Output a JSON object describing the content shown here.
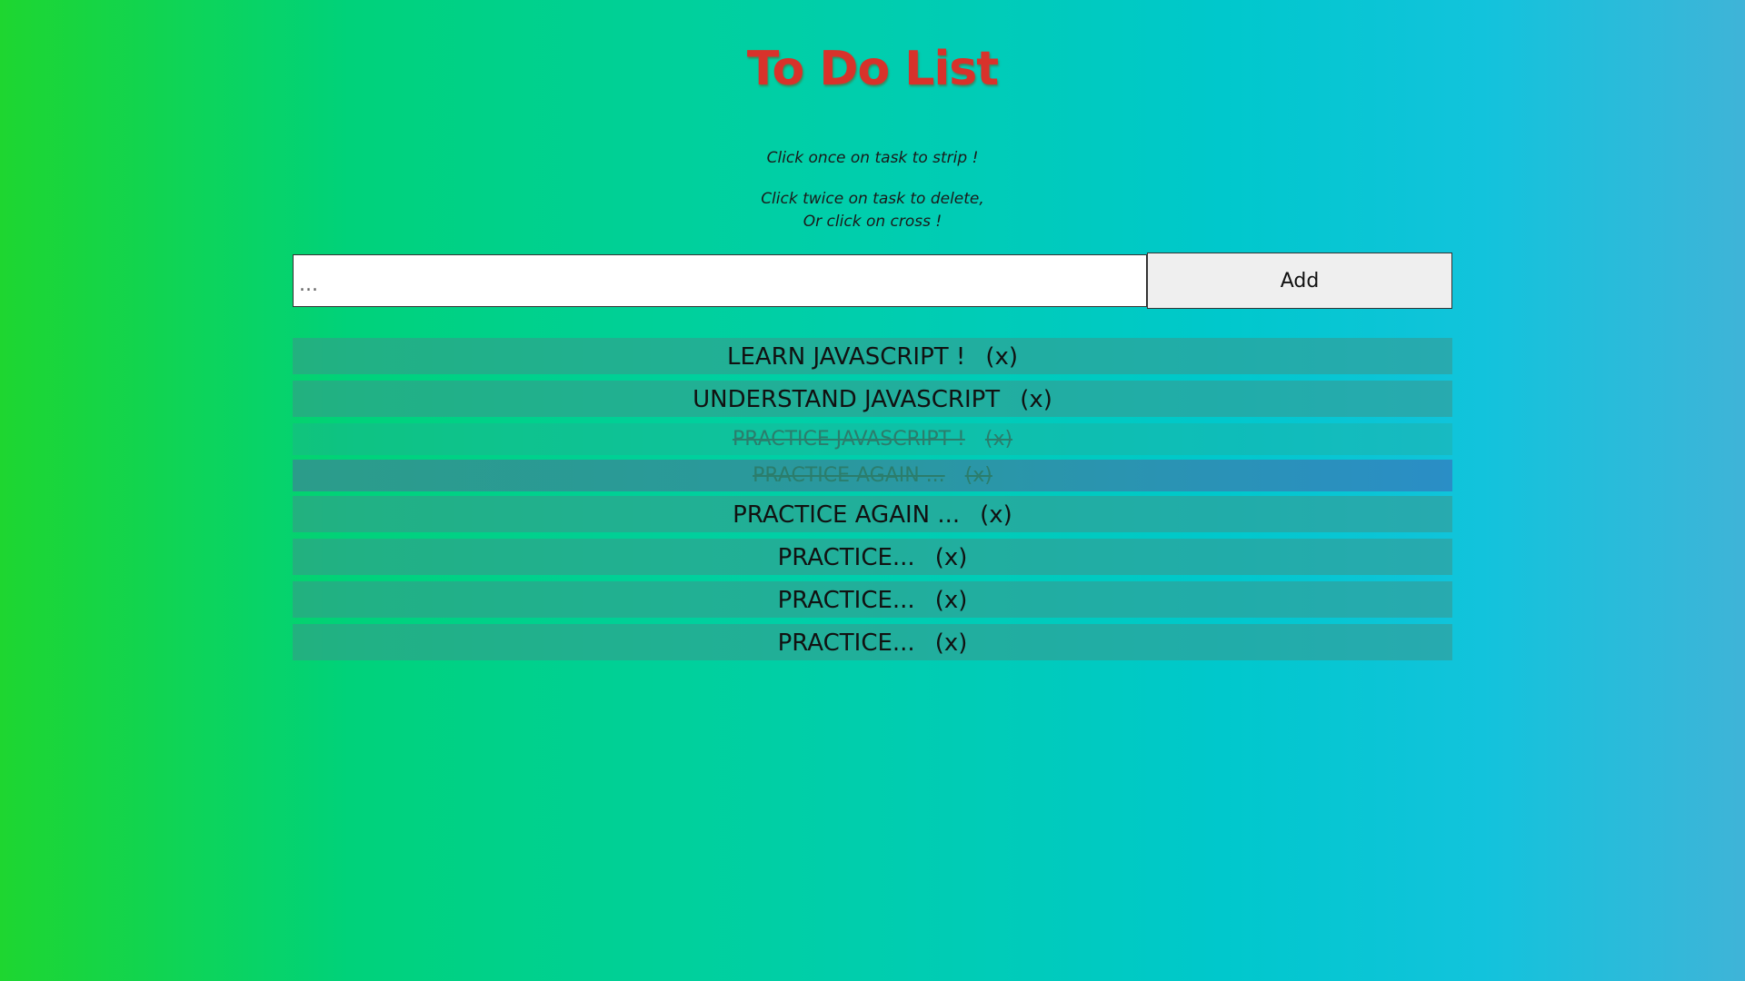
{
  "header": {
    "title": "To Do List"
  },
  "instructions": {
    "line1": "Click once on task to strip !",
    "line2": "Click twice on task to delete,",
    "line3": "Or click on cross !"
  },
  "input": {
    "placeholder": "...",
    "value": ""
  },
  "add_button": {
    "label": "Add"
  },
  "tasks": [
    {
      "text": "LEARN JAVASCRIPT !",
      "cross": "(x)",
      "done": false
    },
    {
      "text": "UNDERSTAND JAVASCRIPT",
      "cross": "(x)",
      "done": false
    },
    {
      "text": "PRACTICE JAVASCRIPT !",
      "cross": "(x)",
      "done": true
    },
    {
      "text": "PRACTICE AGAIN ...",
      "cross": "(x)",
      "done": true
    },
    {
      "text": "PRACTICE AGAIN ...",
      "cross": "(x)",
      "done": false
    },
    {
      "text": "PRACTICE...",
      "cross": "(x)",
      "done": false
    },
    {
      "text": "PRACTICE...",
      "cross": "(x)",
      "done": false
    },
    {
      "text": "PRACTICE...",
      "cross": "(x)",
      "done": false
    }
  ],
  "colors": {
    "title": "#d8322b",
    "background_start": "#1ed630",
    "background_end": "#3fb4d8"
  }
}
